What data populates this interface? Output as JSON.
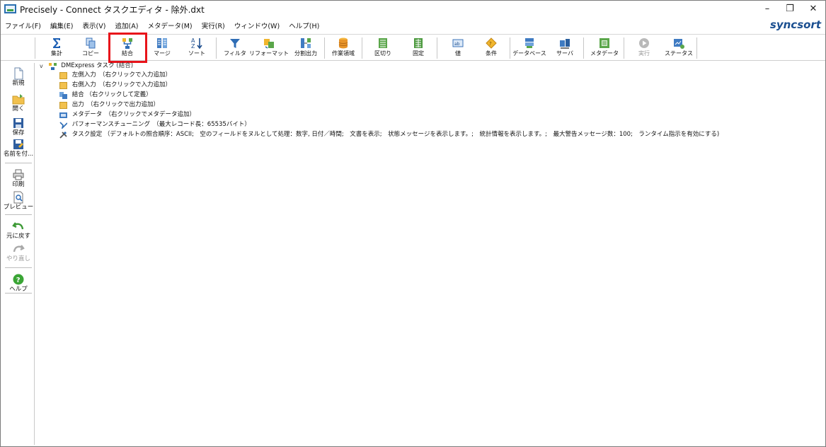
{
  "window": {
    "title": "Precisely - Connect タスクエディタ - 除外.dxt",
    "controls": {
      "minimize": "–",
      "restore": "❐",
      "close": "✕"
    }
  },
  "menubar": {
    "items": [
      "ファイル(F)",
      "編集(E)",
      "表示(V)",
      "追加(A)",
      "メタデータ(M)",
      "実行(R)",
      "ウィンドウ(W)",
      "ヘルプ(H)"
    ],
    "brand": "syncsort"
  },
  "toolbar": {
    "buttons": [
      {
        "label": "集計",
        "icon": "sigma-icon"
      },
      {
        "label": "コピー",
        "icon": "copy-icon"
      },
      {
        "label": "結合",
        "icon": "join-icon",
        "highlighted": true
      },
      {
        "label": "マージ",
        "icon": "merge-icon"
      },
      {
        "label": "ソート",
        "icon": "sort-icon"
      },
      {
        "label": "フィルタ",
        "icon": "filter-icon"
      },
      {
        "label": "リフォーマット",
        "icon": "reformat-icon"
      },
      {
        "label": "分割出力",
        "icon": "split-output-icon"
      },
      {
        "label": "作業領域",
        "icon": "work-area-icon"
      },
      {
        "label": "区切り",
        "icon": "delimiter-icon"
      },
      {
        "label": "固定",
        "icon": "fixed-icon"
      },
      {
        "label": "値",
        "icon": "value-icon"
      },
      {
        "label": "条件",
        "icon": "condition-icon"
      },
      {
        "label": "データベース",
        "icon": "database-icon"
      },
      {
        "label": "サーバ",
        "icon": "server-icon"
      },
      {
        "label": "メタデータ",
        "icon": "metadata-icon"
      },
      {
        "label": "実行",
        "icon": "run-icon",
        "disabled": true
      },
      {
        "label": "ステータス",
        "icon": "status-icon"
      }
    ]
  },
  "sidebar": {
    "buttons": [
      {
        "label": "新規",
        "icon": "new-file-icon"
      },
      {
        "label": "開く",
        "icon": "open-folder-icon"
      },
      {
        "label": "保存",
        "icon": "save-icon"
      },
      {
        "label": "名前を付...",
        "icon": "save-as-icon"
      },
      {
        "label": "印刷",
        "icon": "print-icon"
      },
      {
        "label": "プレビュー",
        "icon": "preview-icon"
      },
      {
        "label": "元に戻す",
        "icon": "undo-icon"
      },
      {
        "label": "やり直し",
        "icon": "redo-icon",
        "disabled": true
      },
      {
        "label": "ヘルプ",
        "icon": "help-icon"
      }
    ]
  },
  "tree": {
    "root": {
      "label": "DMExpress タスク",
      "badge": "(結合)",
      "expander": "v"
    },
    "children": [
      {
        "label": "左側入力　（右クリックで入力追加）",
        "icon": "folder-icon"
      },
      {
        "label": "右側入力　（右クリックで入力追加）",
        "icon": "folder-icon"
      },
      {
        "label": "結合 （右クリックして定義）",
        "icon": "join-node-icon"
      },
      {
        "label": "出力　（右クリックで出力追加）",
        "icon": "folder-icon"
      },
      {
        "label": "メタデータ　（右クリックでメタデータ追加）",
        "icon": "metadata-node-icon"
      },
      {
        "label": "パフォーマンスチューニング　（最大レコード長：65535バイト）",
        "icon": "tuning-icon"
      },
      {
        "label": "タスク設定 （デフォルトの照合順序：ASCII;　空のフィールドをヌルとして処理：数字, 日付／時間;　文書を表示;　状態メッセージを表示します。;　統計情報を表示します。;　最大警告メッセージ数：100;　ランタイム指示を有効にする)",
        "icon": "settings-icon"
      }
    ]
  },
  "colors": {
    "brand": "#1b4f90",
    "highlight": "#e8131a",
    "folder": "#f2c14e"
  }
}
